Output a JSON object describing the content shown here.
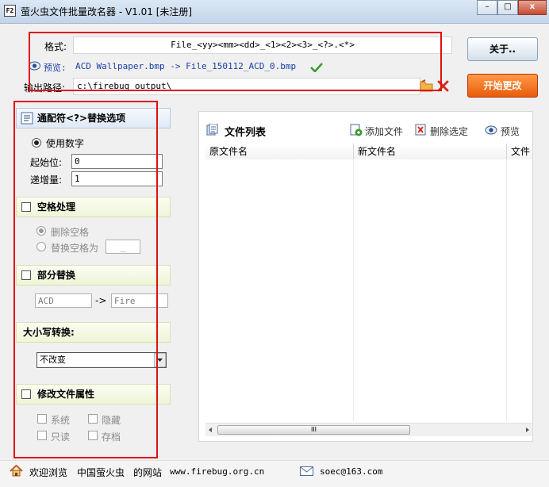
{
  "window": {
    "title": "萤火虫文件批量改名器 - V1.01 [未注册]",
    "app_icon_text": "F2",
    "minimize": "–",
    "maximize": "□",
    "close": "x"
  },
  "format": {
    "label": "格式:",
    "value": "File_<yy><mm><dd>_<1><2><3>_<?>.<*>"
  },
  "preview": {
    "label": "预览:",
    "value": "ACD Wallpaper.bmp -> File_150112_ACD_0.bmp"
  },
  "output": {
    "label": "输出路径:",
    "value": "c:\\firebug_output\\"
  },
  "buttons": {
    "about": "关于..",
    "start": "开始更改"
  },
  "wildcard": {
    "title": "通配符<?>替换选项",
    "use_number": "使用数字",
    "start_label": "起始位:",
    "start_value": "0",
    "step_label": "递增量:",
    "step_value": "1"
  },
  "space": {
    "title": "空格处理",
    "delete": "删除空格",
    "replace": "替换空格为",
    "replace_value": "_"
  },
  "partial": {
    "title": "部分替换",
    "from": "ACD",
    "arrow": "->",
    "to": "Fire"
  },
  "case": {
    "title": "大小写转换:",
    "selected": "不改变"
  },
  "attrs": {
    "title": "修改文件属性",
    "system": "系统",
    "hidden": "隐藏",
    "readonly": "只读",
    "archive": "存档"
  },
  "file_list": {
    "title": "文件列表",
    "add": "添加文件",
    "remove": "删除选定",
    "preview": "预览",
    "columns": [
      "原文件名",
      "新文件名",
      "文件"
    ],
    "scroll_grip": "III"
  },
  "status": {
    "welcome": "欢迎浏览",
    "site_name": "中国萤火虫",
    "site_suffix": "的网站",
    "url": "www.firebug.org.cn",
    "email": "soec@163.com"
  }
}
